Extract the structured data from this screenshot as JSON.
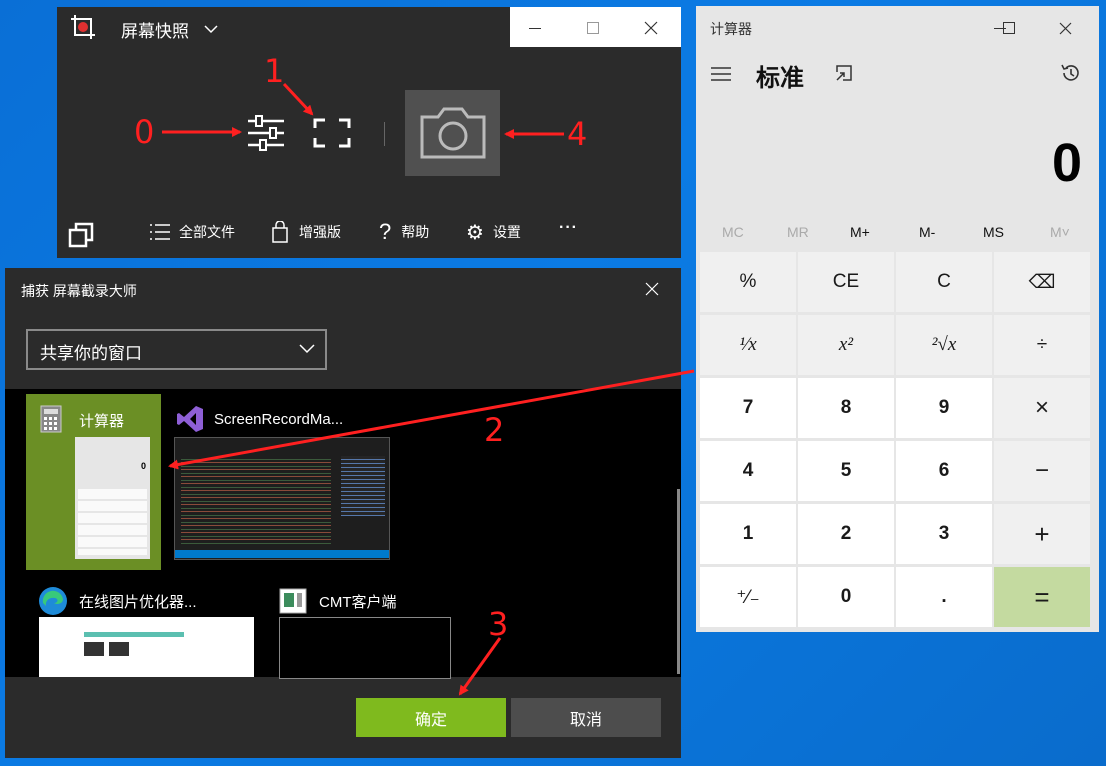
{
  "snapshot_window": {
    "title": "屏幕快照",
    "toolbar": {
      "all_files": "全部文件",
      "pro": "增强版",
      "help": "帮助",
      "settings": "设置",
      "more": "···"
    }
  },
  "capture_dialog": {
    "title": "捕获 屏幕截录大师",
    "dropdown_value": "共享你的窗口",
    "tiles": [
      {
        "title": "计算器",
        "selected": true
      },
      {
        "title": "ScreenRecordMa..."
      },
      {
        "title": "在线图片优化器..."
      },
      {
        "title": "CMT客户端"
      }
    ],
    "confirm": "确定",
    "cancel": "取消"
  },
  "calculator": {
    "title": "计算器",
    "mode": "标准",
    "display": "0",
    "memory": [
      "MC",
      "MR",
      "M+",
      "M-",
      "MS",
      "M˅"
    ],
    "keys": [
      "%",
      "CE",
      "C",
      "⌫",
      "¹⁄x",
      "x²",
      "²√x",
      "÷",
      "7",
      "8",
      "9",
      "×",
      "4",
      "5",
      "6",
      "−",
      "1",
      "2",
      "3",
      "+",
      "⁺⁄₋",
      "0",
      ".",
      "="
    ]
  },
  "annotations": [
    "0",
    "1",
    "2",
    "3",
    "4"
  ],
  "colors": {
    "accent_green": "#7fba1e",
    "equals": "#c4daa0",
    "annotation": "#ff2020",
    "desktop": "#0a6fd6"
  }
}
